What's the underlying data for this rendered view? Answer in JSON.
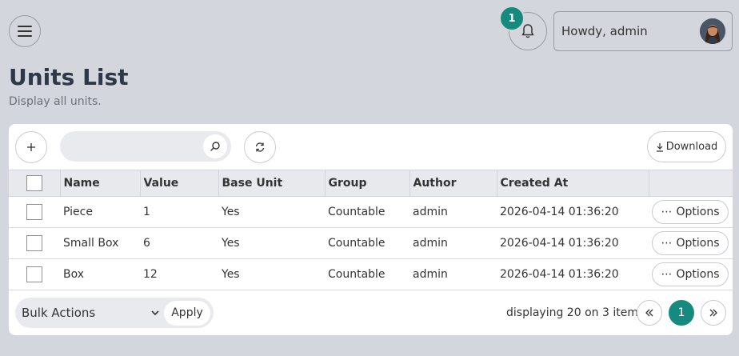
{
  "header": {
    "notification_count": "1",
    "greeting": "Howdy, admin"
  },
  "page": {
    "title": "Units List",
    "subtitle": "Display all units."
  },
  "toolbar": {
    "search_placeholder": "",
    "download_label": "Download"
  },
  "table": {
    "columns": [
      "Name",
      "Value",
      "Base Unit",
      "Group",
      "Author",
      "Created At"
    ],
    "rows": [
      {
        "name": "Piece",
        "value": "1",
        "base_unit": "Yes",
        "group": "Countable",
        "author": "admin",
        "created_at": "2026-04-14 01:36:20"
      },
      {
        "name": "Small Box",
        "value": "6",
        "base_unit": "Yes",
        "group": "Countable",
        "author": "admin",
        "created_at": "2026-04-14 01:36:20"
      },
      {
        "name": "Box",
        "value": "12",
        "base_unit": "Yes",
        "group": "Countable",
        "author": "admin",
        "created_at": "2026-04-14 01:36:20"
      }
    ],
    "options_label": "Options"
  },
  "footer": {
    "bulk_actions_label": "Bulk Actions",
    "apply_label": "Apply",
    "count_text": "displaying 20 on 3 items",
    "current_page": "1"
  },
  "colors": {
    "accent": "#168a7e",
    "background": "#d4d6de"
  }
}
